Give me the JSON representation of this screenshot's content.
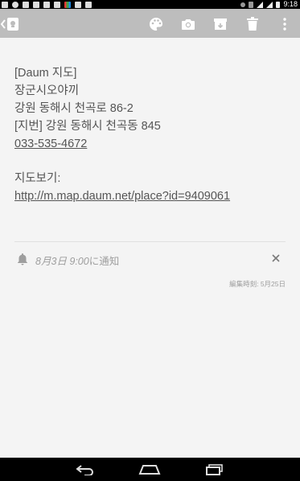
{
  "status_bar": {
    "time": "9:18"
  },
  "note": {
    "lines": [
      "[Daum 지도]",
      "장군시오야끼",
      "강원 동해시 천곡로 86-2",
      "[지번] 강원 동해시 천곡동 845",
      "033-535-4672",
      "",
      "지도보기:",
      "http://m.map.daum.net/place?id=9409061"
    ]
  },
  "reminder": {
    "date": "8月3日 9:00",
    "suffix": "に通知"
  },
  "edited_label": "編集時刻: 5月25日",
  "colors": {
    "toolbar": "#bdbdbd",
    "background": "#f4f4f4",
    "text": "#555555"
  }
}
